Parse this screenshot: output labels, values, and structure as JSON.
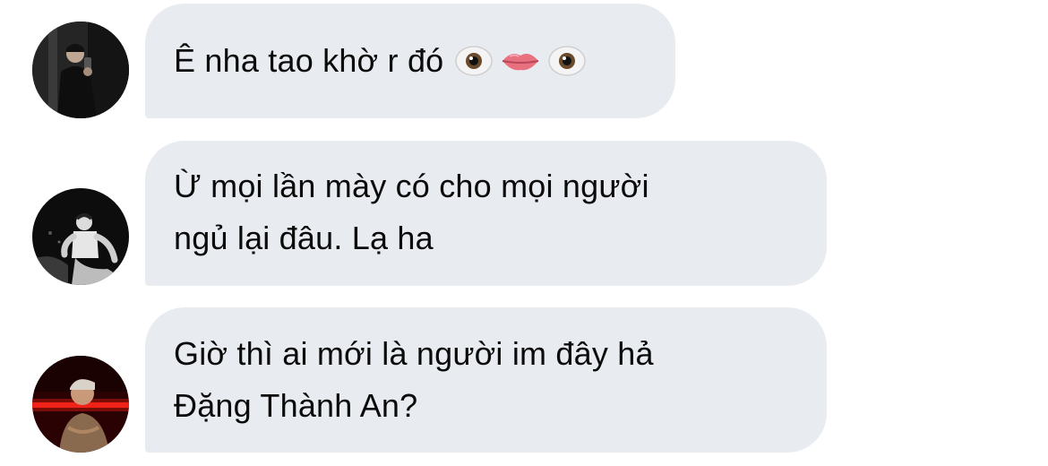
{
  "messages": [
    {
      "avatar": "avatar-person-mirror-selfie",
      "lines": [
        "Ê nha tao khờ r đó"
      ],
      "emojis": [
        "eyes-icon-left",
        "lips-icon",
        "eyes-icon-right"
      ]
    },
    {
      "avatar": "avatar-person-bw-sitting",
      "lines": [
        "Ừ mọi lần mày có cho mọi người",
        "ngủ lại đâu. Lạ ha"
      ],
      "emojis": []
    },
    {
      "avatar": "avatar-person-red-light",
      "lines": [
        "Giờ thì ai mới là người im đây hả",
        "Đặng Thành An?"
      ],
      "emojis": []
    }
  ],
  "colors": {
    "bubble": "#e8ebf0",
    "text": "#0b0b0b",
    "background": "#ffffff"
  }
}
